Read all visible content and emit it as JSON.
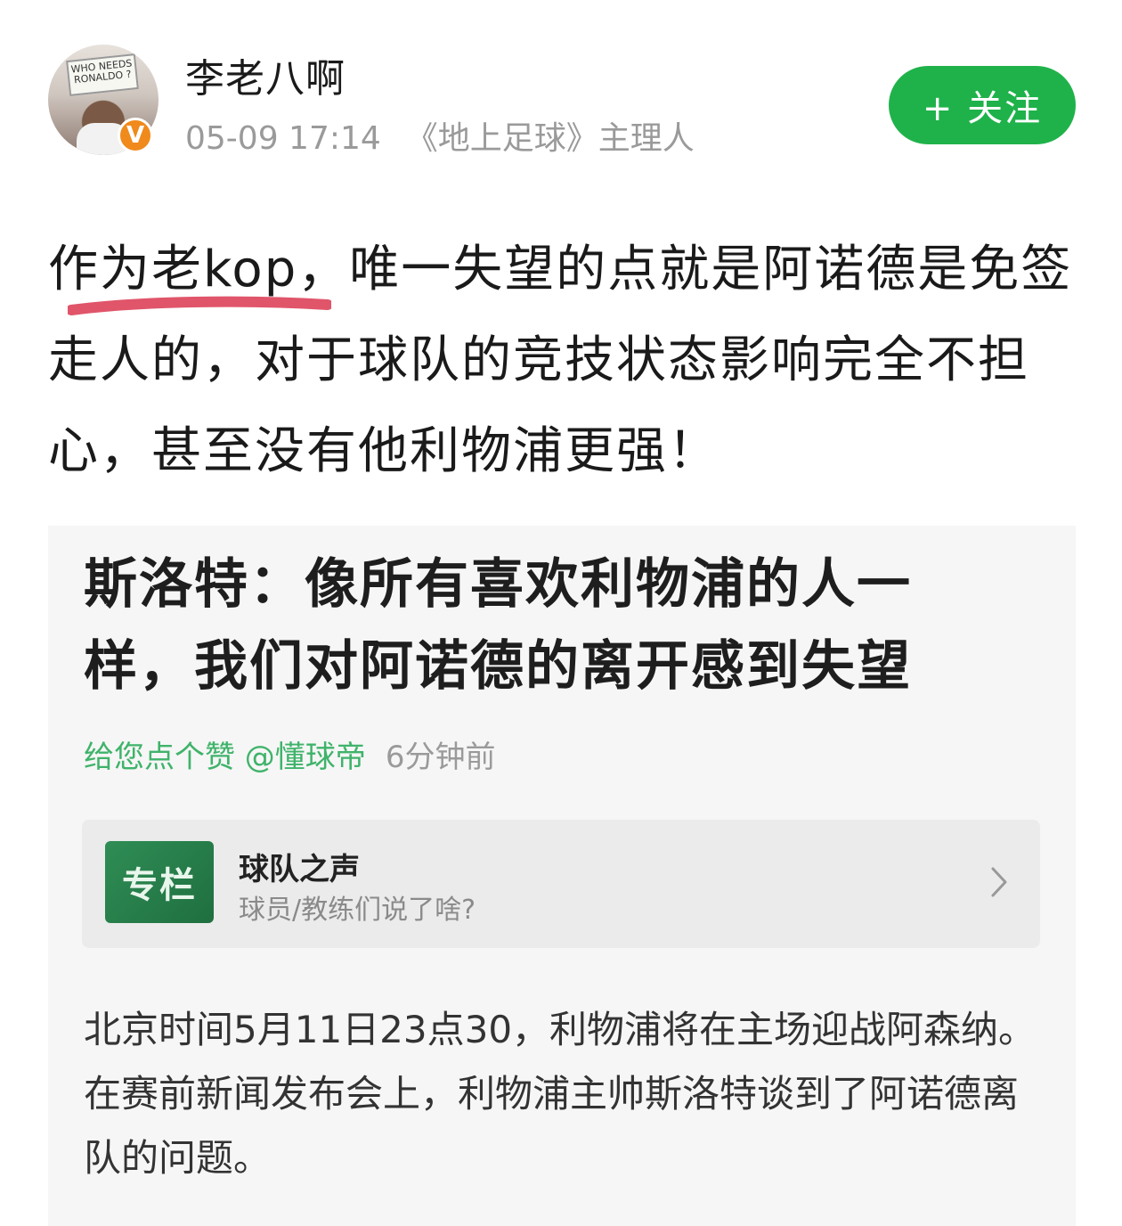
{
  "header": {
    "avatar_sign_text": "WHO NEEDS RONALDO ?",
    "badge_label": "V",
    "username": "李老八啊",
    "timestamp": "05-09 17:14",
    "role": "《地上足球》主理人",
    "follow_label": "+ 关注",
    "follow_color": "#1fb24a"
  },
  "post": {
    "text": "作为老kop，唯一失望的点就是阿诺德是免签走人的，对于球队的竞技状态影响完全不担心，甚至没有他利物浦更强！",
    "underline_color": "#e0556a"
  },
  "card": {
    "title": "斯洛特：像所有喜欢利物浦的人一样，我们对阿诺德的离开感到失望",
    "meta_green": "给您点个赞 @懂球帝",
    "meta_time": "6分钟前",
    "column": {
      "thumb_label": "专栏",
      "title": "球队之声",
      "subtitle": "球员/教练们说了啥?"
    },
    "body": "北京时间5月11日23点30，利物浦将在主场迎战阿森纳。在赛前新闻发布会上，利物浦主帅斯洛特谈到了阿诺德离队的问题。"
  }
}
